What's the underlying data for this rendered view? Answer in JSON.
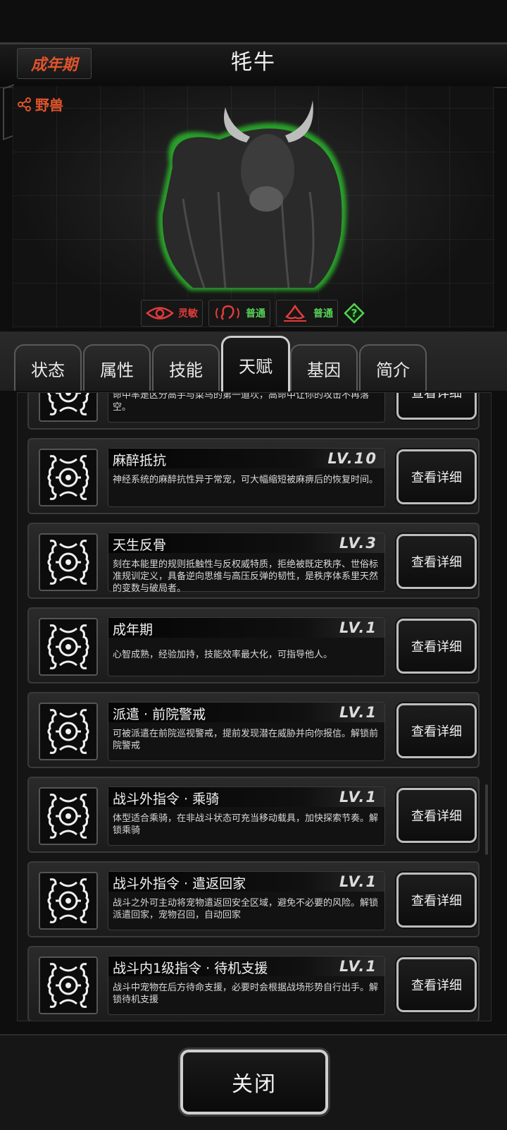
{
  "header": {
    "stage_badge": "成年期",
    "title": "牦牛"
  },
  "species": {
    "label": "野兽",
    "icon": "share-icon"
  },
  "traits": [
    {
      "icon": "eye-icon",
      "label": "灵敏",
      "color": "#e23b3b"
    },
    {
      "icon": "ear-icon",
      "label": "普通",
      "color": "#58d158"
    },
    {
      "icon": "nose-icon",
      "label": "普通",
      "color": "#58d158"
    }
  ],
  "tabs": [
    {
      "label": "状态"
    },
    {
      "label": "属性"
    },
    {
      "label": "技能"
    },
    {
      "label": "天赋",
      "active": true
    },
    {
      "label": "基因"
    },
    {
      "label": "简介"
    }
  ],
  "talents": [
    {
      "name": "",
      "level": "",
      "desc": "命中率是区分高手与菜鸟的第一道坎，高命中让你的攻击不再落空。",
      "button": "查看详细"
    },
    {
      "name": "麻醉抵抗",
      "level": "LV.10",
      "desc": "神经系统的麻醉抗性异于常宠，可大幅缩短被麻痹后的恢复时间。",
      "button": "查看详细"
    },
    {
      "name": "天生反骨",
      "level": "LV.3",
      "desc": "刻在本能里的规则抵触性与反权威特质，拒绝被既定秩序、世俗标准规训定义，具备逆向思维与高压反弹的韧性，是秩序体系里天然的变数与破局者。",
      "button": "查看详细"
    },
    {
      "name": "成年期",
      "level": "LV.1",
      "desc": "心智成熟，经验加持，技能效率最大化，可指导他人。",
      "button": "查看详细"
    },
    {
      "name": "派遣 · 前院警戒",
      "level": "LV.1",
      "desc": "可被派遣在前院巡视警戒，提前发现潜在威胁并向你报信。解锁前院警戒",
      "button": "查看详细"
    },
    {
      "name": "战斗外指令 · 乘骑",
      "level": "LV.1",
      "desc": "体型适合乘骑，在非战斗状态可充当移动载具，加快探索节奏。解锁乘骑",
      "button": "查看详细"
    },
    {
      "name": "战斗外指令 · 遣返回家",
      "level": "LV.1",
      "desc": "战斗之外可主动将宠物遣返回安全区域，避免不必要的风险。解锁派遣回家，宠物召回，自动回家",
      "button": "查看详细"
    },
    {
      "name": "战斗内1级指令 · 待机支援",
      "level": "LV.1",
      "desc": "战斗中宠物在后方待命支援，必要时会根据战场形势自行出手。解锁待机支援",
      "button": "查看详细"
    }
  ],
  "footer": {
    "close_label": "关闭"
  }
}
